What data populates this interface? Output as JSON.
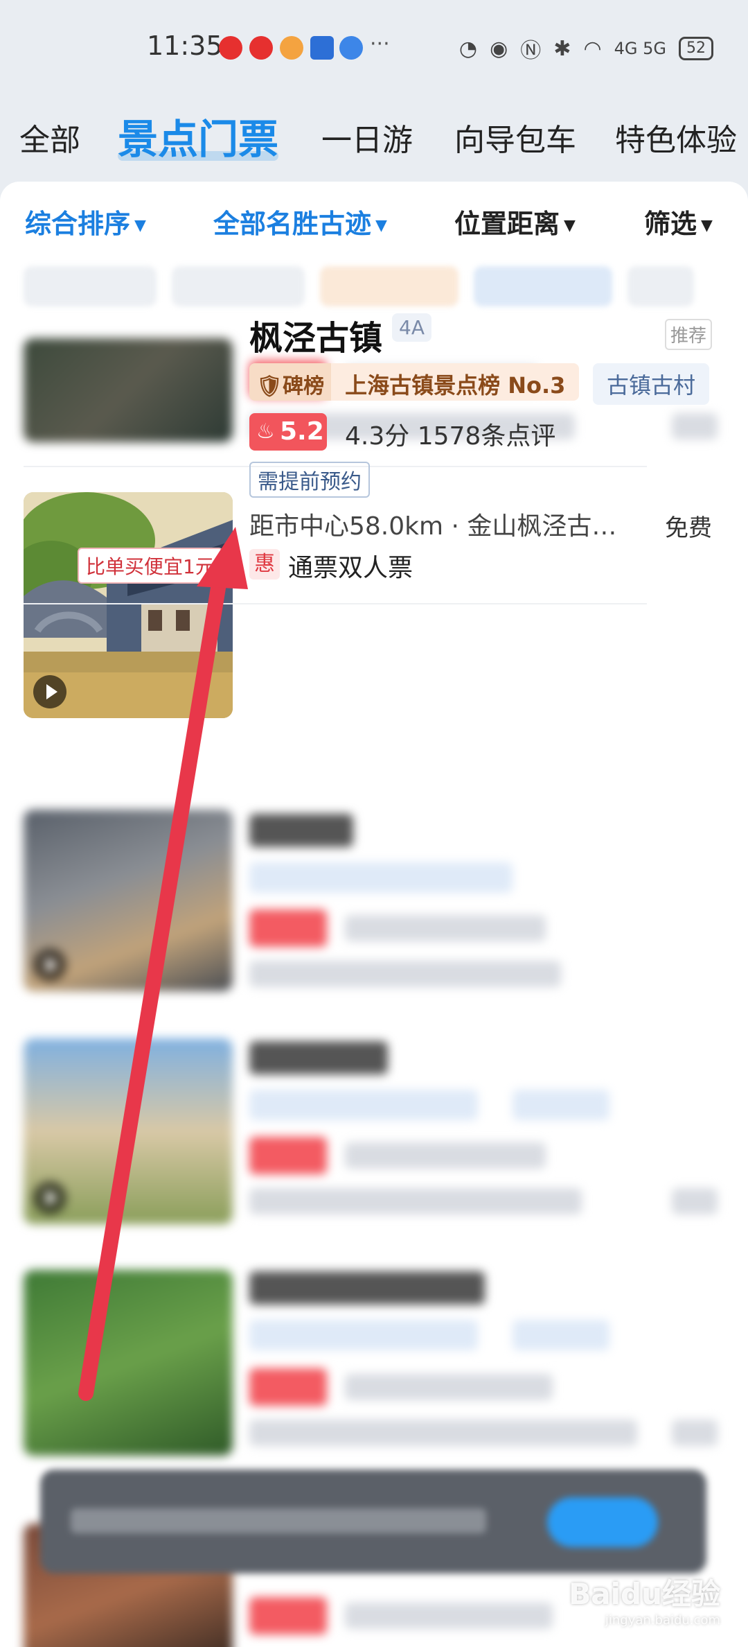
{
  "status_bar": {
    "time": "11:35",
    "network": "4G 5G",
    "battery": "52"
  },
  "tabs": [
    {
      "label": "全部"
    },
    {
      "label": "景点门票"
    },
    {
      "label": "一日游"
    },
    {
      "label": "向导包车"
    },
    {
      "label": "特色体验"
    }
  ],
  "filters": [
    {
      "label": "综合排序"
    },
    {
      "label": "全部名胜古迹"
    },
    {
      "label": "位置距离"
    },
    {
      "label": "筛选"
    }
  ],
  "featured": {
    "name": "枫泾古镇",
    "grade": "4A",
    "tag_recommend": "推荐",
    "rank_badge": "碑榜",
    "rank_text": "上海古镇景点榜 No.3",
    "category": "古镇古村",
    "heat": "5.2",
    "rating": "4.3分 1578条点评",
    "booking_note": "需提前预约",
    "distance": "距市中心58.0km · 金山枫泾古…",
    "price": "免费",
    "savings": "比单买便宜1元",
    "promo_icon": "惠",
    "package": "通票双人票"
  },
  "colors": {
    "accent": "#1b8ae8",
    "heat": "#f2555c",
    "arrow": "#e8374a"
  },
  "watermark": {
    "text": "Baidu经验",
    "url": "jingyan.baidu.com"
  }
}
